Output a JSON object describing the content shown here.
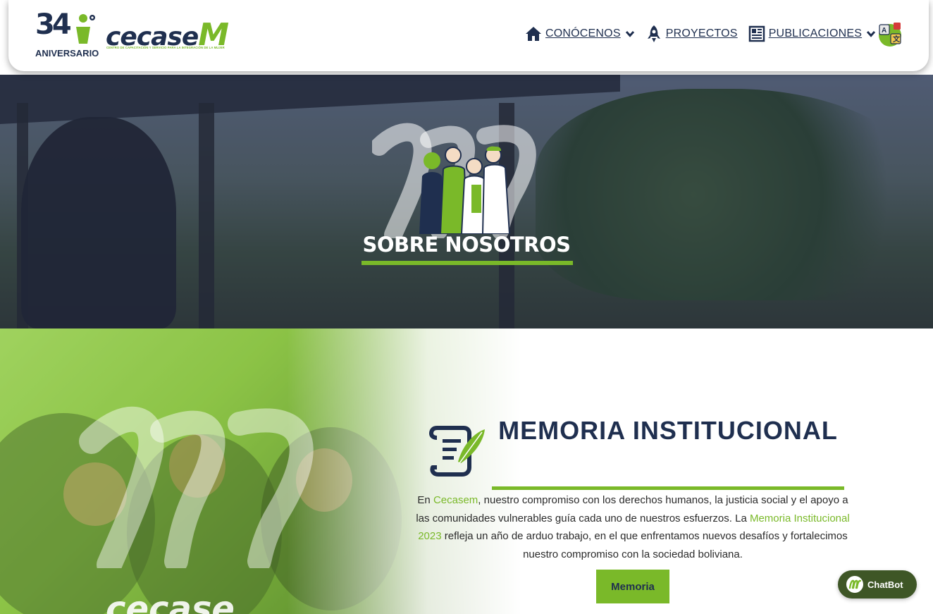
{
  "header": {
    "logo": {
      "anniversary_number": "34",
      "anniversary_label": "ANIVERSARIO",
      "brand_name": "cecase",
      "brand_m": "M",
      "brand_tagline": "CENTRO DE CAPACITACIÓN Y SERVICIO PARA LA INTEGRACIÓN DE LA MUJER"
    },
    "nav": [
      {
        "label": "CONÓCENOS",
        "icon": "home-icon",
        "has_dropdown": true
      },
      {
        "label": "PROYECTOS",
        "icon": "rocket-icon",
        "has_dropdown": false
      },
      {
        "label": "PUBLICACIONES",
        "icon": "newspaper-icon",
        "has_dropdown": true
      }
    ],
    "language_icon": "translate-icon"
  },
  "hero": {
    "title": "SOBRE NOSOTROS"
  },
  "memoria": {
    "title": "MEMORIA INSTITUCIONAL",
    "text_1": "En ",
    "highlight_1": "Cecasem",
    "text_2": ", nuestro compromiso con los derechos humanos, la justicia social y el apoyo a las comunidades vulnerables guía cada uno de nuestros esfuerzos. La ",
    "highlight_2": "Memoria Institucional 2023",
    "text_3": " refleja un año de arduo trabajo, en el que enfrentamos nuevos desafíos y fortalecimos nuestro compromiso con la sociedad boliviana.",
    "button_label": "Memoria",
    "watermark_brand": "cecase"
  },
  "chatbot": {
    "label": "ChatBot"
  },
  "colors": {
    "navy": "#1f2f4f",
    "green": "#7ab929",
    "chatbot_bg": "#3e5626"
  }
}
